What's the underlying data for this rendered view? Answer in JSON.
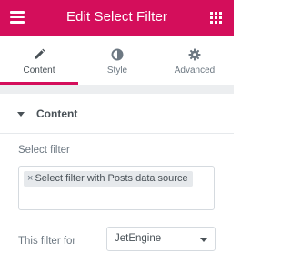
{
  "theme": {
    "accent": "#d40e5b",
    "panel_gap": "#eceef0"
  },
  "header": {
    "title": "Edit Select Filter",
    "menu_icon": "hamburger-icon",
    "widgets_icon": "grid-icon"
  },
  "tabs": [
    {
      "label": "Content",
      "icon": "pencil-icon",
      "active": true
    },
    {
      "label": "Style",
      "icon": "half-circle-icon",
      "active": false
    },
    {
      "label": "Advanced",
      "icon": "gear-icon",
      "active": false
    }
  ],
  "section": {
    "title": "Content",
    "expanded": true
  },
  "select_filter": {
    "label": "Select filter",
    "chips": [
      {
        "remove": "×",
        "text": "Select filter with Posts data source"
      }
    ]
  },
  "filter_for": {
    "label": "This filter for",
    "value": "JetEngine"
  }
}
